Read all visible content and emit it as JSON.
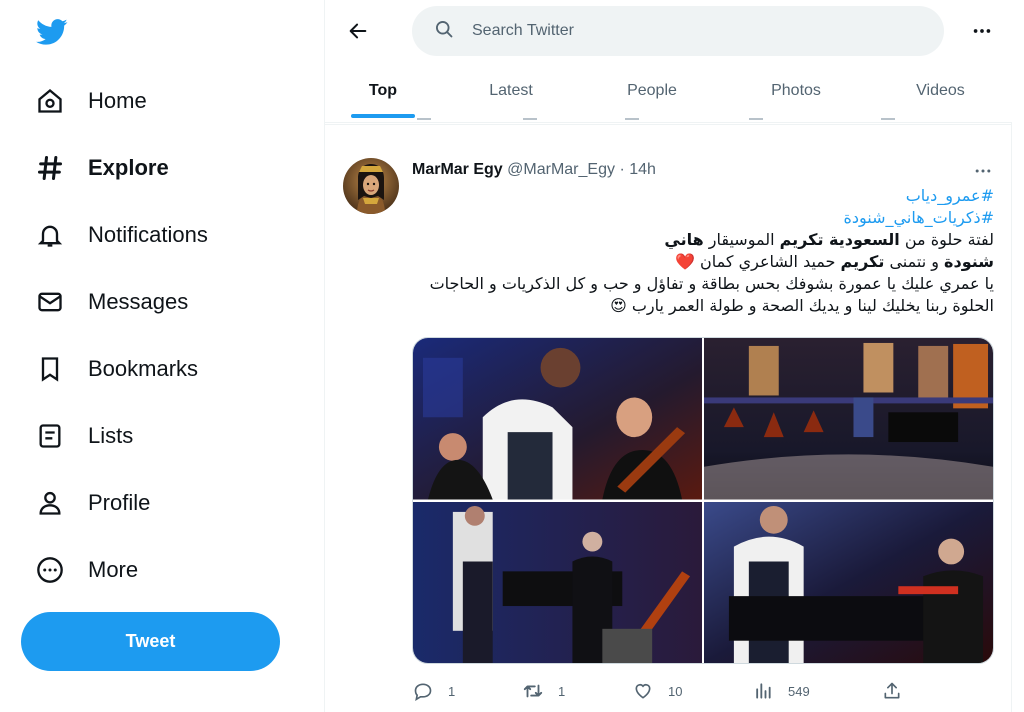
{
  "sidebar": {
    "items": [
      {
        "label": "Home",
        "icon": "home-icon"
      },
      {
        "label": "Explore",
        "icon": "hashtag-icon",
        "active": true
      },
      {
        "label": "Notifications",
        "icon": "bell-icon"
      },
      {
        "label": "Messages",
        "icon": "envelope-icon"
      },
      {
        "label": "Bookmarks",
        "icon": "bookmark-icon"
      },
      {
        "label": "Lists",
        "icon": "list-icon"
      },
      {
        "label": "Profile",
        "icon": "person-icon"
      },
      {
        "label": "More",
        "icon": "more-circle-icon"
      }
    ],
    "tweet_label": "Tweet"
  },
  "header": {
    "search_placeholder": "Search Twitter",
    "tabs": [
      "Top",
      "Latest",
      "People",
      "Photos",
      "Videos"
    ],
    "active_tab": "Top"
  },
  "tweet": {
    "name": "MarMar Egy",
    "handle": "@MarMar_Egy",
    "dot": "·",
    "time": "14h",
    "hashtags": [
      "#عمرو_دياب",
      "#ذكريات_هاني_شنودة"
    ],
    "line1_a": "لفتة حلوة من ",
    "line1_b": "السعودية تكريم",
    "line1_c": " الموسيقار ",
    "line1_d": "هاني",
    "line2_a": "شنودة",
    "line2_b": " و نتمنى ",
    "line2_c": "تكريم",
    "line2_d": " حميد الشاعري كمان ",
    "line2_emoji": "❤️",
    "line3": "يا عمري عليك يا عمورة بشوفك بحس بطاقة و تفاؤل و حب و كل الذكريات و الحاجات",
    "line4": "الحلوة ربنا يخليك لينا و يديك الصحة و طولة العمر يارب ",
    "line4_emoji": "😍",
    "stats": {
      "replies": "1",
      "retweets": "1",
      "likes": "10",
      "views": "549"
    }
  },
  "colors": {
    "accent": "#1d9bf0",
    "text": "#0f1419",
    "secondary": "#536471",
    "border": "#eff3f4"
  }
}
